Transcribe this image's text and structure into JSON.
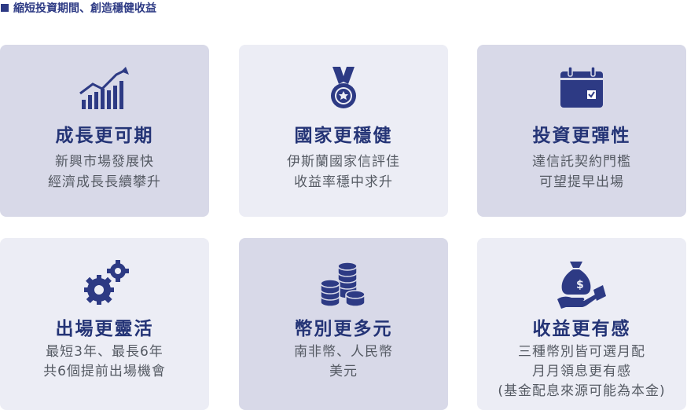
{
  "header": {
    "title": "縮短投資期間、創造穩健收益"
  },
  "cards": [
    {
      "title": "成長更可期",
      "lines": [
        "新興市場發展快",
        "經濟成長長續攀升"
      ],
      "icon": "bar-chart-growth-icon"
    },
    {
      "title": "國家更穩健",
      "lines": [
        "伊斯蘭國家信評佳",
        "收益率穩中求升"
      ],
      "icon": "medal-icon"
    },
    {
      "title": "投資更彈性",
      "lines": [
        "達信託契約門檻",
        "可望提早出場"
      ],
      "icon": "calendar-check-icon"
    },
    {
      "title": "出場更靈活",
      "lines": [
        "最短3年、最長6年",
        "共6個提前出場機會"
      ],
      "icon": "gears-icon"
    },
    {
      "title": "幣別更多元",
      "lines": [
        "南非幣、人民幣",
        "美元"
      ],
      "icon": "coin-stacks-icon"
    },
    {
      "title": "收益更有感",
      "lines": [
        "三種幣別皆可選月配",
        "月月領息更有感",
        "(基金配息來源可能為本金)"
      ],
      "icon": "money-bag-hand-icon"
    }
  ],
  "colors": {
    "accent": "#2d3a84",
    "card_dark": "#d8d9e8",
    "card_light": "#ecedf5"
  }
}
